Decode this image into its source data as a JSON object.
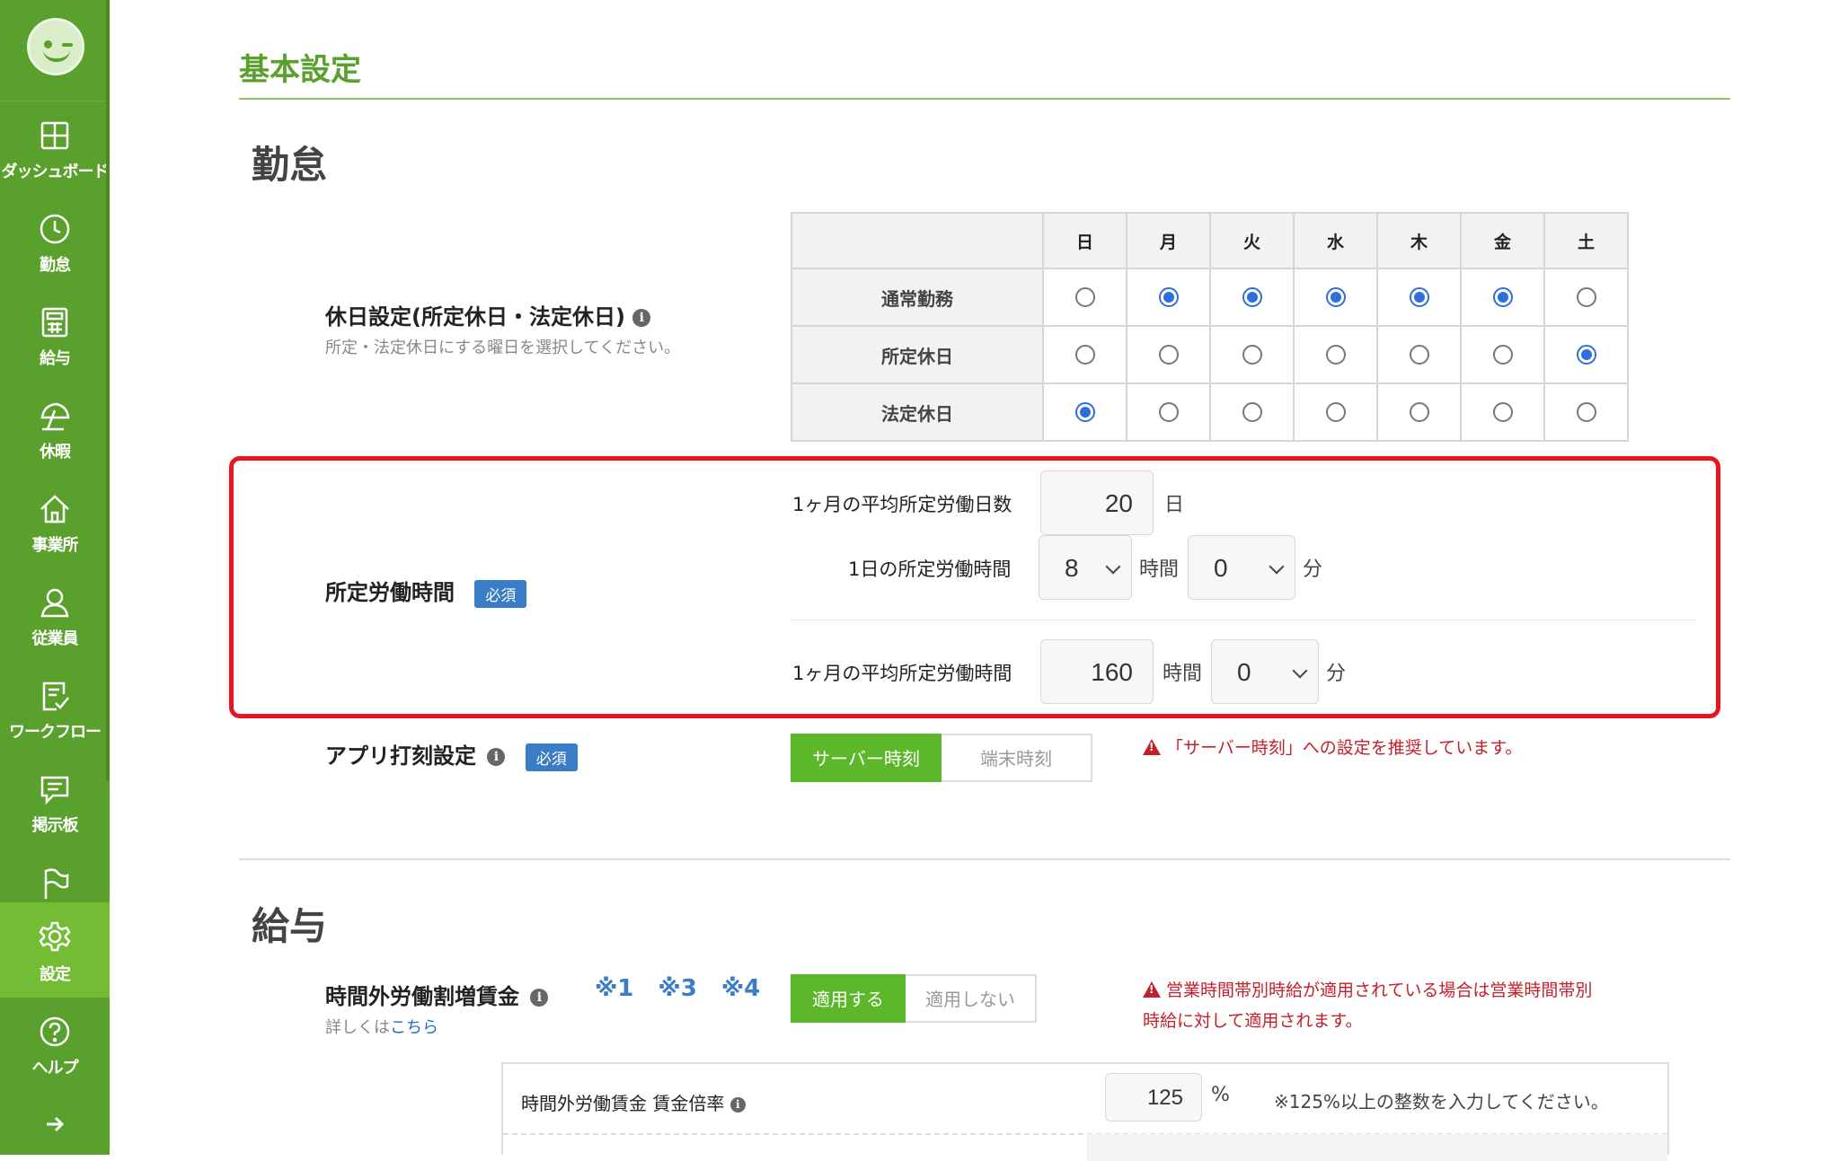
{
  "sidebar": {
    "items": [
      {
        "label": "ダッシュボード",
        "icon": "dashboard-icon"
      },
      {
        "label": "勤怠",
        "icon": "clock-icon"
      },
      {
        "label": "給与",
        "icon": "calculator-icon"
      },
      {
        "label": "休暇",
        "icon": "umbrella-icon"
      },
      {
        "label": "事業所",
        "icon": "home-icon"
      },
      {
        "label": "従業員",
        "icon": "person-icon"
      },
      {
        "label": "ワークフロー",
        "icon": "checklist-icon"
      },
      {
        "label": "掲示板",
        "icon": "chat-icon"
      },
      {
        "label": "",
        "icon": "flag-icon"
      },
      {
        "label": "設定",
        "icon": "gear-icon"
      },
      {
        "label": "ヘルプ",
        "icon": "help-icon"
      }
    ],
    "active": "設定",
    "expand_icon": "arrow-right-icon"
  },
  "page": {
    "title": "基本設定"
  },
  "attendance": {
    "section_title": "勤怠",
    "holiday": {
      "title": "休日設定(所定休日・法定休日)",
      "help": "所定・法定休日にする曜日を選択してください。",
      "days": [
        "日",
        "月",
        "火",
        "水",
        "木",
        "金",
        "土"
      ],
      "rows": [
        {
          "label": "通常勤務",
          "selected": [
            false,
            true,
            true,
            true,
            true,
            true,
            false
          ]
        },
        {
          "label": "所定休日",
          "selected": [
            false,
            false,
            false,
            false,
            false,
            false,
            true
          ]
        },
        {
          "label": "法定休日",
          "selected": [
            true,
            false,
            false,
            false,
            false,
            false,
            false
          ]
        }
      ]
    },
    "work_hours": {
      "title": "所定労働時間",
      "required": "必須",
      "avg_days_label": "1ヶ月の平均所定労働日数",
      "avg_days_value": "20",
      "avg_days_unit": "日",
      "daily_label": "1日の所定労働時間",
      "daily_hours": "8",
      "daily_minutes": "0",
      "monthly_label": "1ヶ月の平均所定労働時間",
      "monthly_hours": "160",
      "monthly_minutes": "0",
      "hour_unit": "時間",
      "minute_unit": "分"
    },
    "app_clock": {
      "title": "アプリ打刻設定",
      "required": "必須",
      "options": [
        "サーバー時刻",
        "端末時刻"
      ],
      "selected": "サーバー時刻",
      "warning": "「サーバー時刻」への設定を推奨しています。"
    }
  },
  "payroll": {
    "section_title": "給与",
    "overtime": {
      "title": "時間外労働割増賃金",
      "marks": "※1 ※3 ※4",
      "detail_prefix": "詳しくは",
      "detail_link": "こちら",
      "options": [
        "適用する",
        "適用しない"
      ],
      "selected": "適用する",
      "warning_line1": "営業時間帯別時給が適用されている場合は営業時間帯別",
      "warning_line2": "時給に対して適用されます。",
      "rate_label": "時間外労働賃金 賃金倍率",
      "rate_value": "125",
      "rate_unit": "%",
      "rate_note": "※125%以上の整数を入力してください。"
    }
  },
  "colors": {
    "brand": "#5aa02c",
    "accent_blue": "#3b7dc4",
    "warning": "#c4202b",
    "highlight": "#e8141e"
  }
}
